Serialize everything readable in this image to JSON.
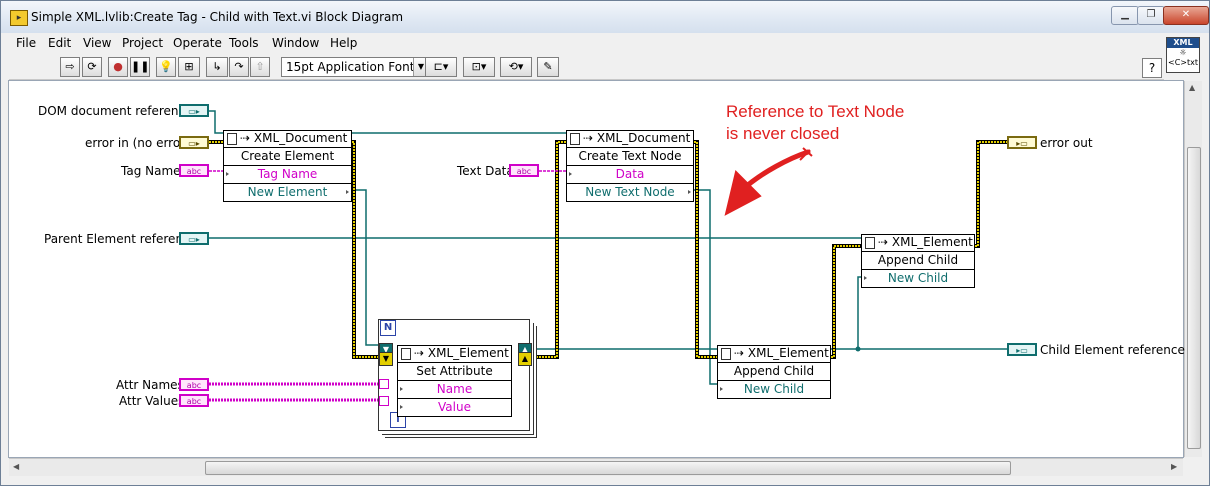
{
  "window": {
    "title": "Simple XML.lvlib:Create Tag - Child with Text.vi Block Diagram",
    "controls": [
      "minimize",
      "restore",
      "close"
    ]
  },
  "menu": [
    "File",
    "Edit",
    "View",
    "Project",
    "Operate",
    "Tools",
    "Window",
    "Help"
  ],
  "toolbar": {
    "font": "15pt Application Font",
    "buttons": [
      "run-arrow-icon",
      "run-continuous-icon",
      "abort-icon",
      "pause-icon",
      "highlight-execution-icon",
      "retain-wire-values-icon",
      "step-into-icon",
      "step-over-icon",
      "step-out-icon",
      "align-objects-icon",
      "distribute-objects-icon",
      "reorder-icon",
      "cleanup-diagram-icon"
    ],
    "help": "?"
  },
  "vi_icon": {
    "top": "XML",
    "bottom": "<C>txt"
  },
  "diagram": {
    "terminals": {
      "dom_ref": "DOM document reference",
      "error_in": "error in (no error)",
      "tag_name": "Tag Name",
      "parent_ref": "Parent Element reference",
      "attr_names": "Attr Names",
      "attr_values": "Attr Values",
      "text_data": "Text Data",
      "error_out": "error out",
      "child_ref": "Child Element reference"
    },
    "terminal_glyphs": {
      "string": "abc",
      "loop_count": "N",
      "loop_index": "i"
    },
    "nodes": {
      "create_element": {
        "class": "XML_Document",
        "method": "Create Element",
        "input": "Tag Name",
        "output": "New Element"
      },
      "create_text_node": {
        "class": "XML_Document",
        "method": "Create Text Node",
        "input": "Data",
        "output": "New Text Node"
      },
      "set_attribute": {
        "class": "XML_Element",
        "method": "Set Attribute",
        "input1": "Name",
        "input2": "Value"
      },
      "append_child_text": {
        "class": "XML_Element",
        "method": "Append Child",
        "input": "New Child"
      },
      "append_child_parent": {
        "class": "XML_Element",
        "method": "Append Child",
        "input": "New Child"
      }
    },
    "annotation": [
      "Reference to Text Node",
      "is never closed"
    ],
    "colors": {
      "reference_wire": "#0f6d6d",
      "error_wire": "#c9b400",
      "string_wire": "#d000c8",
      "annotation": "#e02020"
    }
  }
}
